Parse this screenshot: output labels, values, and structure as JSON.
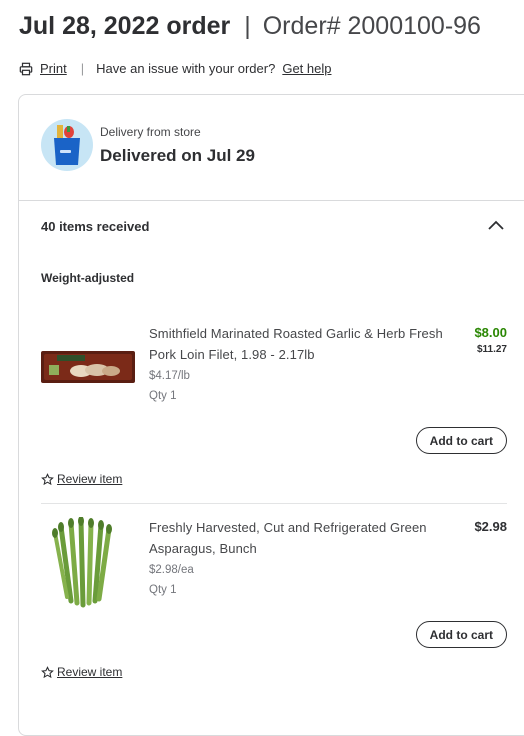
{
  "header": {
    "date_title": "Jul 28, 2022 order",
    "separator": "|",
    "order_number": "Order# 2000100-96"
  },
  "toolbar": {
    "print_label": "Print",
    "issue_text": "Have an issue with your order?",
    "help_label": "Get help"
  },
  "delivery": {
    "type": "Delivery from store",
    "status": "Delivered on Jul 29"
  },
  "items_section": {
    "count_label": "40 items received",
    "group_label": "Weight-adjusted"
  },
  "items": [
    {
      "name": "Smithfield Marinated Roasted Garlic & Herb Fresh Pork Loin Filet, 1.98 - 2.17lb",
      "unit_price": "$4.17/lb",
      "qty": "Qty 1",
      "price": "$8.00",
      "original_price": "$11.27",
      "cart_label": "Add to cart",
      "review_label": "Review item"
    },
    {
      "name": "Freshly Harvested, Cut and Refrigerated Green Asparagus, Bunch",
      "unit_price": "$2.98/ea",
      "qty": "Qty 1",
      "price": "$2.98",
      "cart_label": "Add to cart",
      "review_label": "Review item"
    }
  ],
  "colors": {
    "price_green": "#2a8703",
    "delivery_circle": "#c7e5f5",
    "text": "#2e2f32"
  }
}
